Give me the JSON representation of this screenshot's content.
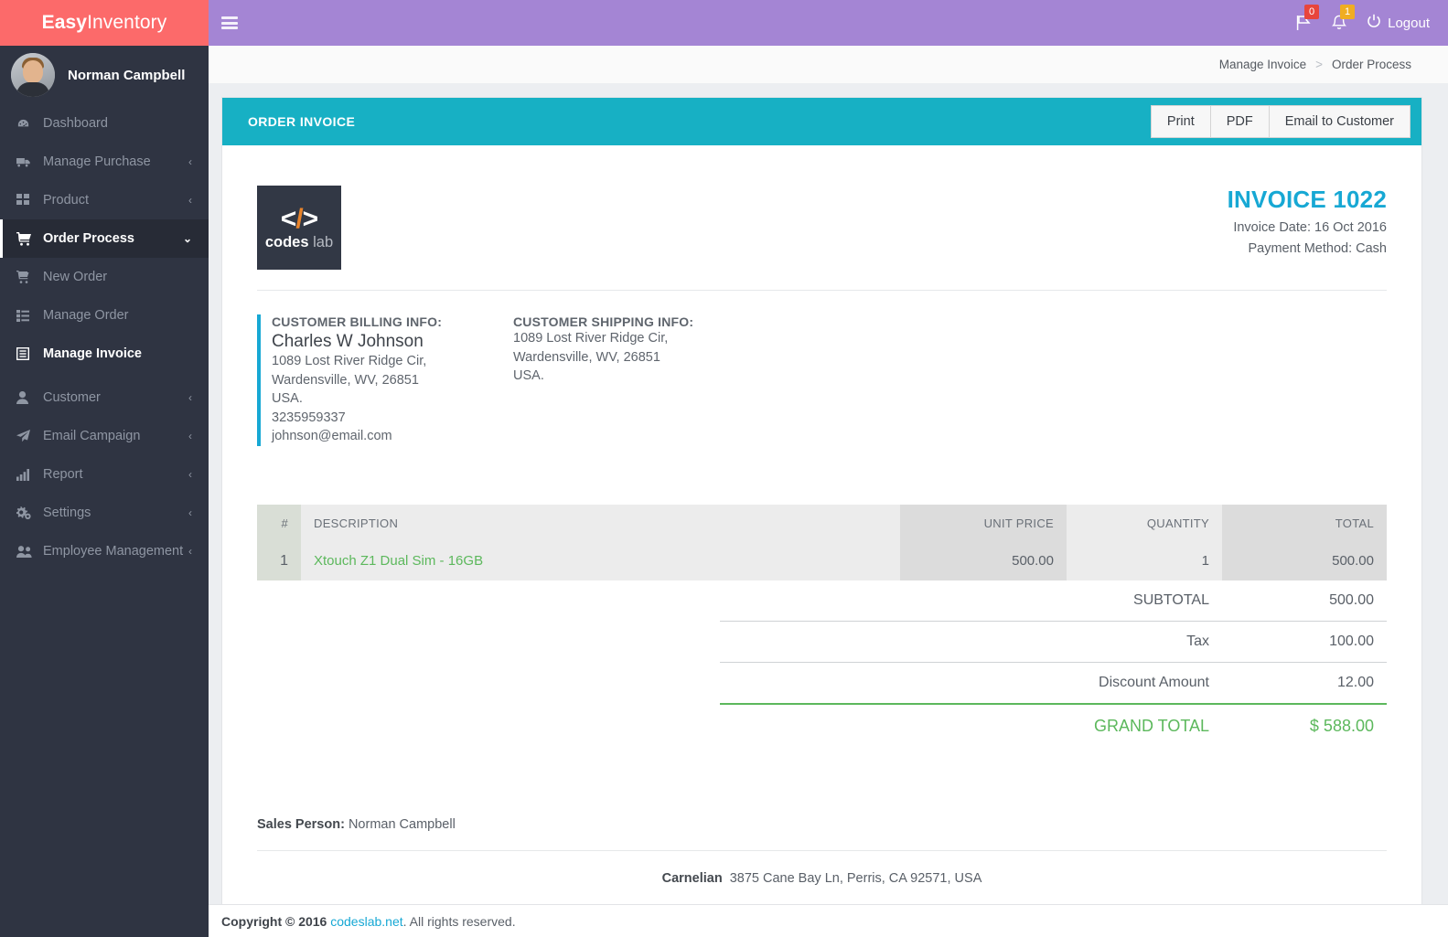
{
  "brand": {
    "part1": "Easy",
    "part2": "Inventory"
  },
  "profile": {
    "name": "Norman Campbell",
    "avatar_icon": "user-avatar"
  },
  "sidebar": {
    "items": [
      {
        "label": "Dashboard",
        "icon": "dashboard-icon",
        "caret": ""
      },
      {
        "label": "Manage Purchase",
        "icon": "truck-icon",
        "caret": "‹"
      },
      {
        "label": "Product",
        "icon": "grid-icon",
        "caret": "‹"
      },
      {
        "label": "Order Process",
        "icon": "cart-icon",
        "caret": "⌄"
      },
      {
        "label": "New Order",
        "icon": "cart-plus-icon",
        "caret": ""
      },
      {
        "label": "Manage Order",
        "icon": "list-icon",
        "caret": ""
      },
      {
        "label": "Manage Invoice",
        "icon": "invoice-icon",
        "caret": ""
      },
      {
        "label": "Customer",
        "icon": "user-icon",
        "caret": "‹"
      },
      {
        "label": "Email Campaign",
        "icon": "paper-plane-icon",
        "caret": "‹"
      },
      {
        "label": "Report",
        "icon": "bar-chart-icon",
        "caret": "‹"
      },
      {
        "label": "Settings",
        "icon": "gears-icon",
        "caret": "‹"
      },
      {
        "label": "Employee Management",
        "icon": "users-icon",
        "caret": "‹"
      }
    ]
  },
  "topbar": {
    "menu_toggle_icon": "hamburger-icon",
    "flag": {
      "icon": "flag-icon",
      "badge": "0"
    },
    "bell": {
      "icon": "bell-icon",
      "badge": "1"
    },
    "logout": {
      "icon": "power-icon",
      "label": "Logout"
    }
  },
  "breadcrumb": {
    "parent": "Manage Invoice",
    "separator": ">",
    "current": "Order Process"
  },
  "panel": {
    "title": "ORDER INVOICE",
    "buttons": [
      {
        "label": "Print",
        "name": "print-button"
      },
      {
        "label": "PDF",
        "name": "pdf-button"
      },
      {
        "label": "Email to Customer",
        "name": "email-to-customer-button"
      }
    ]
  },
  "logo": {
    "glyph_left": "<",
    "glyph_slash": "/",
    "glyph_right": ">",
    "word1": "codes",
    "word2": " lab"
  },
  "invoice": {
    "number": "INVOICE 1022",
    "date_line": "Invoice Date: 16 Oct 2016",
    "payment_line": "Payment Method: Cash"
  },
  "billing": {
    "title": "CUSTOMER BILLING INFO:",
    "name": "Charles W Johnson",
    "line1": "1089 Lost River Ridge Cir,",
    "line2": "Wardensville, WV, 26851",
    "line3": "USA.",
    "phone": "3235959337",
    "email": "johnson@email.com"
  },
  "shipping": {
    "title": "CUSTOMER SHIPPING INFO:",
    "line1": "1089 Lost River Ridge Cir,",
    "line2": "Wardensville, WV, 26851",
    "line3": "USA."
  },
  "items_table": {
    "headers": {
      "hash": "#",
      "description": "DESCRIPTION",
      "unit_price": "UNIT PRICE",
      "quantity": "QUANTITY",
      "total": "TOTAL"
    },
    "rows": [
      {
        "index": "1",
        "description": "Xtouch Z1 Dual Sim - 16GB",
        "unit_price": "500.00",
        "quantity": "1",
        "total": "500.00"
      }
    ]
  },
  "totals": {
    "subtotal_label": "SUBTOTAL",
    "subtotal_value": "500.00",
    "tax_label": "Tax",
    "tax_value": "100.00",
    "discount_label": "Discount Amount",
    "discount_value": "12.00",
    "grand_label": "GRAND TOTAL",
    "grand_value": "$ 588.00"
  },
  "sales_person": {
    "label": "Sales Person:",
    "value": "Norman Campbell"
  },
  "company": {
    "name": "Carnelian",
    "address": "3875 Cane Bay Ln, Perris, CA 92571, USA"
  },
  "footer": {
    "copy": "Copyright © 2016",
    "link": "codeslab.net",
    "rest": ". All rights reserved."
  },
  "colors": {
    "brand_red": "#fc6a6a",
    "sidebar_dark": "#2f3442",
    "topbar_purple": "#a485d4",
    "panel_teal": "#17b0c4",
    "invoice_blue": "#17a8d4",
    "accent_green": "#5cb85c",
    "logo_orange": "#e8832a",
    "badge_red": "#e8453c",
    "badge_orange": "#f0ad22"
  }
}
